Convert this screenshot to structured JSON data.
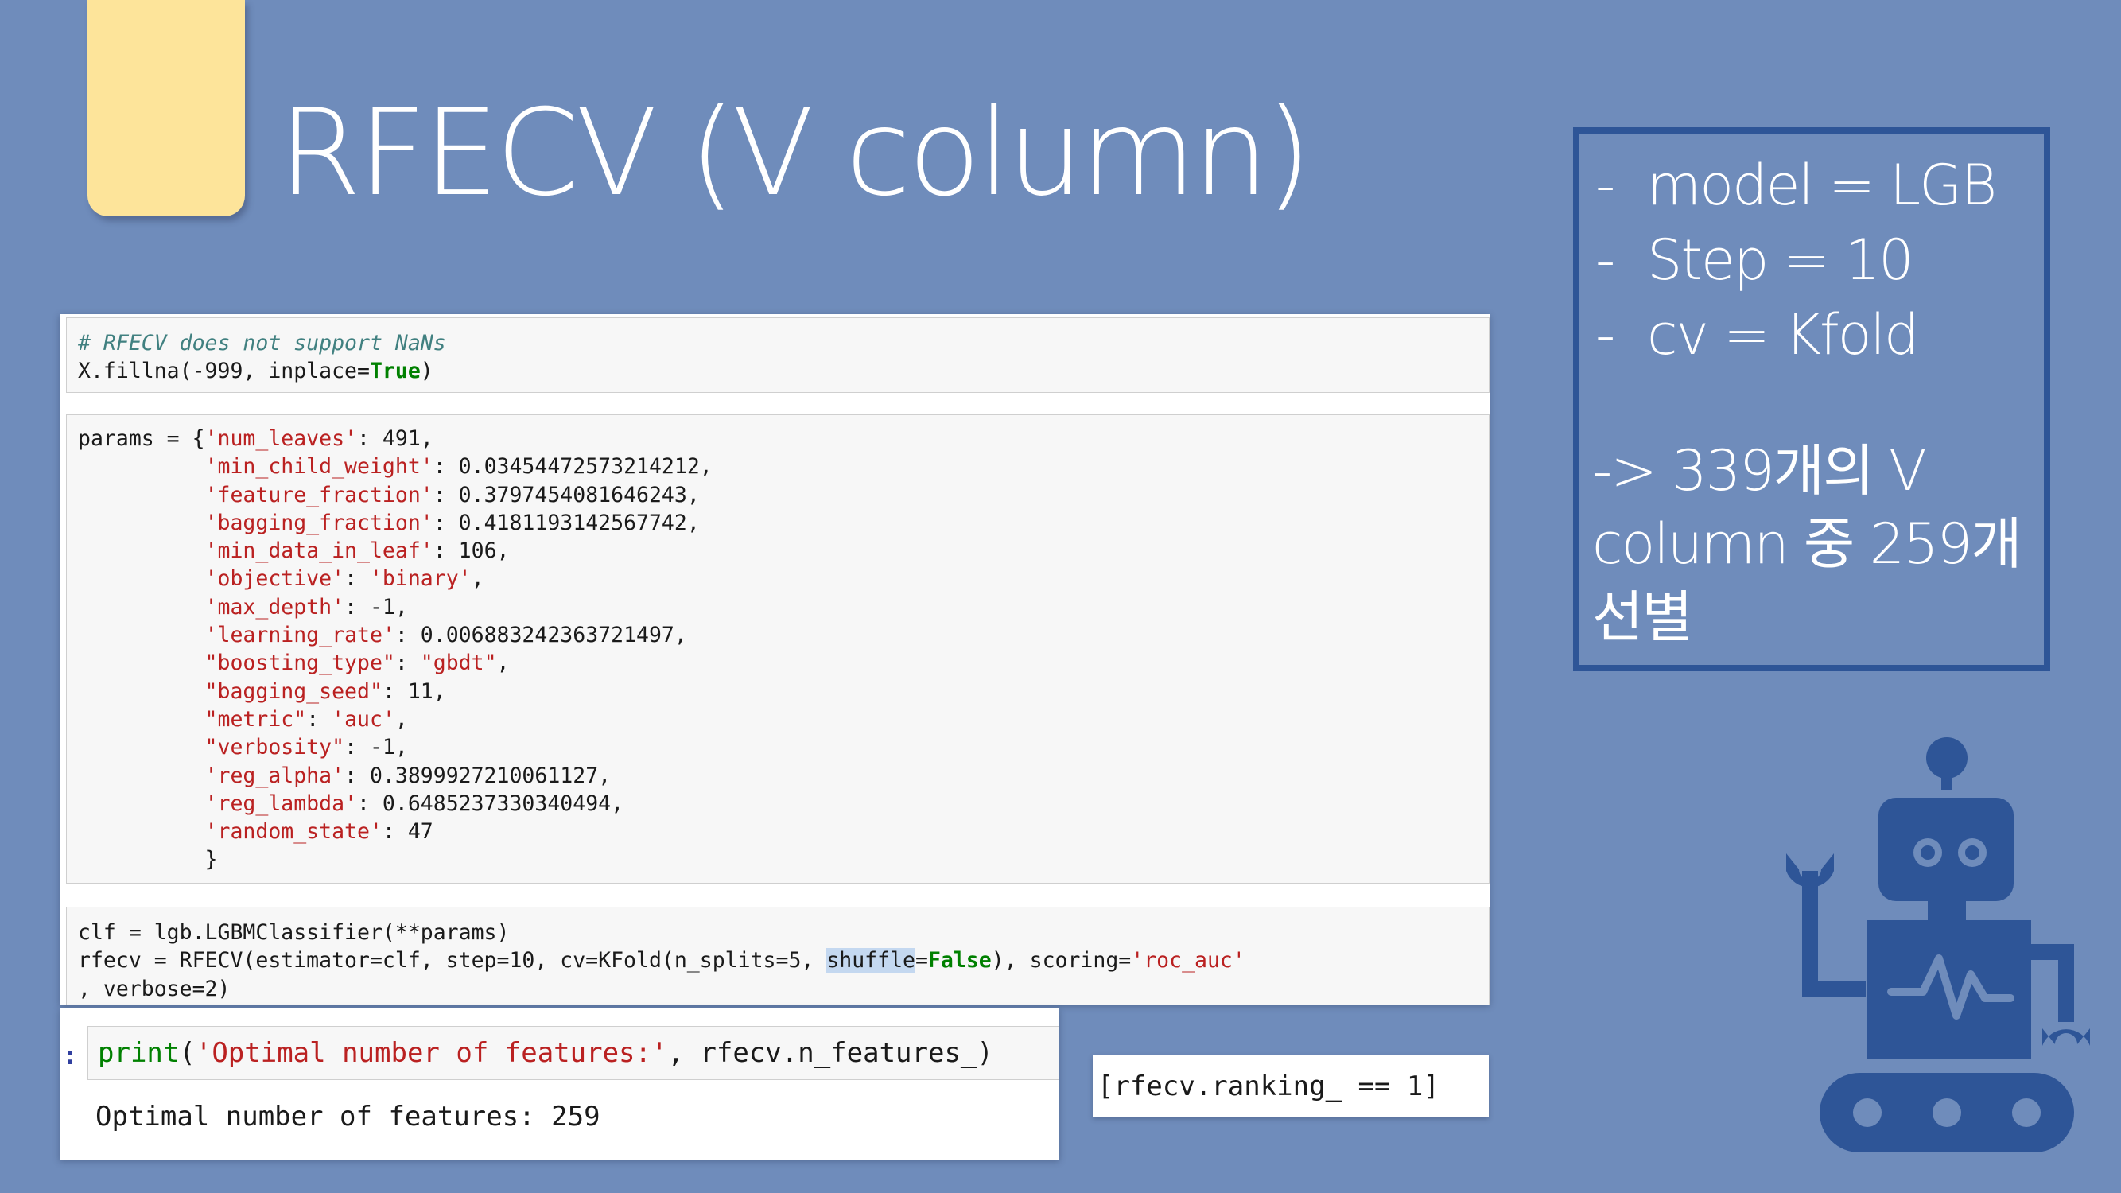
{
  "slide": {
    "title": "RFECV (V column)"
  },
  "notebook": {
    "cell1": {
      "comment": "# RFECV does not support NaNs",
      "line2_pre": "X.fillna(-999, inplace=",
      "line2_kw": "True",
      "line2_post": ")"
    },
    "cell3": {
      "line1": "clf = lgb.LGBMClassifier(**params)",
      "line2_a": "rfecv = RFECV(estimator=clf, step=10, cv=KFold(n_splits=5, ",
      "line2_hl": "shuffle",
      "line2_eq": "=",
      "line2_kw": "False",
      "line2_b": "), scoring=",
      "line2_str": "'roc_auc'",
      "line3": ", verbose=2)"
    }
  },
  "params": {
    "opening": "params = {",
    "closing": "}",
    "entries": [
      {
        "key": "'num_leaves'",
        "value": "491"
      },
      {
        "key": "'min_child_weight'",
        "value": "0.03454472573214212"
      },
      {
        "key": "'feature_fraction'",
        "value": "0.3797454081646243"
      },
      {
        "key": "'bagging_fraction'",
        "value": "0.4181193142567742"
      },
      {
        "key": "'min_data_in_leaf'",
        "value": "106"
      },
      {
        "key": "'objective'",
        "value": "'binary'",
        "value_is_string": true
      },
      {
        "key": "'max_depth'",
        "value": "-1"
      },
      {
        "key": "'learning_rate'",
        "value": "0.006883242363721497"
      },
      {
        "key": "\"boosting_type\"",
        "value": "\"gbdt\"",
        "value_is_string": true
      },
      {
        "key": "\"bagging_seed\"",
        "value": "11"
      },
      {
        "key": "\"metric\"",
        "value": "'auc'",
        "value_is_string": true
      },
      {
        "key": "\"verbosity\"",
        "value": "-1"
      },
      {
        "key": "'reg_alpha'",
        "value": "0.3899927210061127"
      },
      {
        "key": "'reg_lambda'",
        "value": "0.6485237330340494"
      },
      {
        "key": "'random_state'",
        "value": "47",
        "last": true
      }
    ]
  },
  "output": {
    "prompt": ":",
    "print_fn": "print",
    "print_open": "(",
    "print_str": "'Optimal number of features:'",
    "print_rest": ", rfecv.n_features_)",
    "result": "Optimal number of features: 259",
    "ranking_expr": "[rfecv.ranking_ == 1]"
  },
  "info": {
    "bullets": [
      {
        "dash": "-",
        "text": "model = LGB"
      },
      {
        "dash": "-",
        "text": "Step = 10"
      },
      {
        "dash": "-",
        "text": "cv = Kfold"
      }
    ],
    "result_lines": [
      "-> 339개의 V",
      "column 중 259개",
      "선별"
    ]
  },
  "colors": {
    "background": "#6f8cbb",
    "tab": "#fde49a",
    "box_border": "#2e5597",
    "robot": "#2e5597",
    "keyword": "#008000",
    "string": "#ba2121",
    "comment": "#408080"
  },
  "icons": {
    "robot": "robot-icon"
  }
}
